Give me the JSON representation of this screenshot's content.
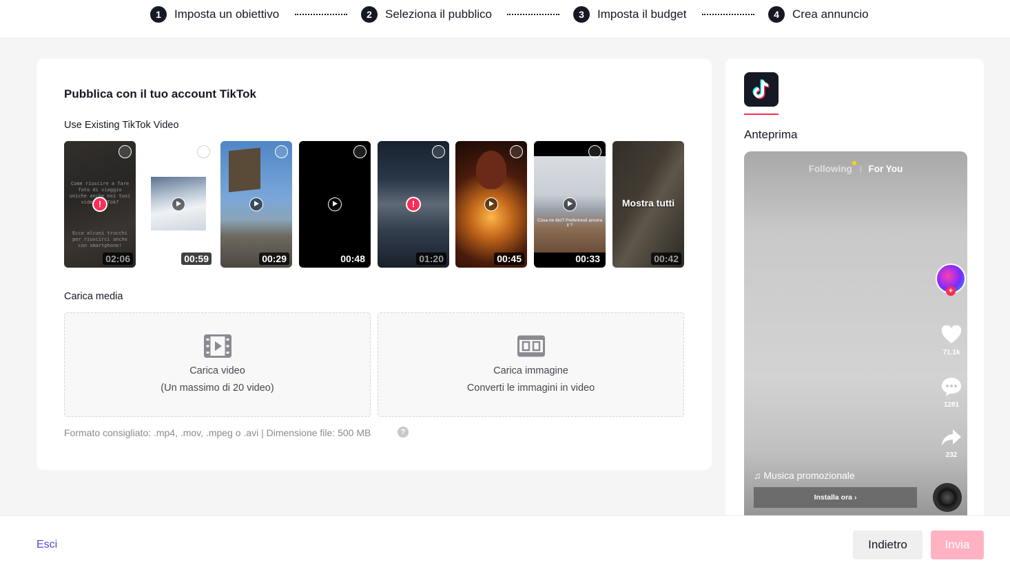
{
  "stepper": {
    "steps": [
      {
        "number": "1",
        "label": "Imposta un obiettivo"
      },
      {
        "number": "2",
        "label": "Seleziona il pubblico"
      },
      {
        "number": "3",
        "label": "Imposta il budget"
      },
      {
        "number": "4",
        "label": "Crea annuncio"
      }
    ]
  },
  "main": {
    "title": "Pubblica con il tuo account TikTok",
    "existing_label": "Use Existing TikTok Video",
    "videos": [
      {
        "duration": "02:06",
        "status": "error",
        "overlay_top": "Come riuscire a fare foto di viaggio uniche anche nei tuoi video TikTok?",
        "overlay_bottom": "Ecco alcuni trucchi per riuscirci anche con smartphone!"
      },
      {
        "duration": "00:59",
        "status": "ok"
      },
      {
        "duration": "00:29",
        "status": "ok"
      },
      {
        "duration": "00:48",
        "status": "ok"
      },
      {
        "duration": "01:20",
        "status": "error"
      },
      {
        "duration": "00:45",
        "status": "ok"
      },
      {
        "duration": "00:33",
        "status": "ok",
        "caption": "Cosa ne dici? Preferiresti ancora il ?"
      },
      {
        "duration": "00:42",
        "status": "show_all",
        "show_all_label": "Mostra tutti"
      }
    ],
    "upload_label": "Carica media",
    "upload_video": {
      "title": "Carica video",
      "subtitle": "(Un massimo di 20 video)"
    },
    "upload_image": {
      "title": "Carica immagine",
      "subtitle": "Converti le immagini in video"
    },
    "format_note": "Formato consigliato: .mp4, .mov, .mpeg o .avi | Dimensione file: 500 MB",
    "help_symbol": "?"
  },
  "preview": {
    "label": "Anteprima",
    "feed_tabs": {
      "following": "Following",
      "for_you": "For You"
    },
    "likes": "71.1k",
    "comments": "1281",
    "shares": "232",
    "music": "Musica promozionale",
    "install_button": "Installa ora",
    "avatar_plus": "+"
  },
  "footer": {
    "exit_label": "Esci",
    "back_label": "Indietro",
    "submit_label": "Invia"
  },
  "colors": {
    "accent": "#fe2c55",
    "submit_disabled": "#ffb3c2",
    "link": "#4c47d9"
  }
}
